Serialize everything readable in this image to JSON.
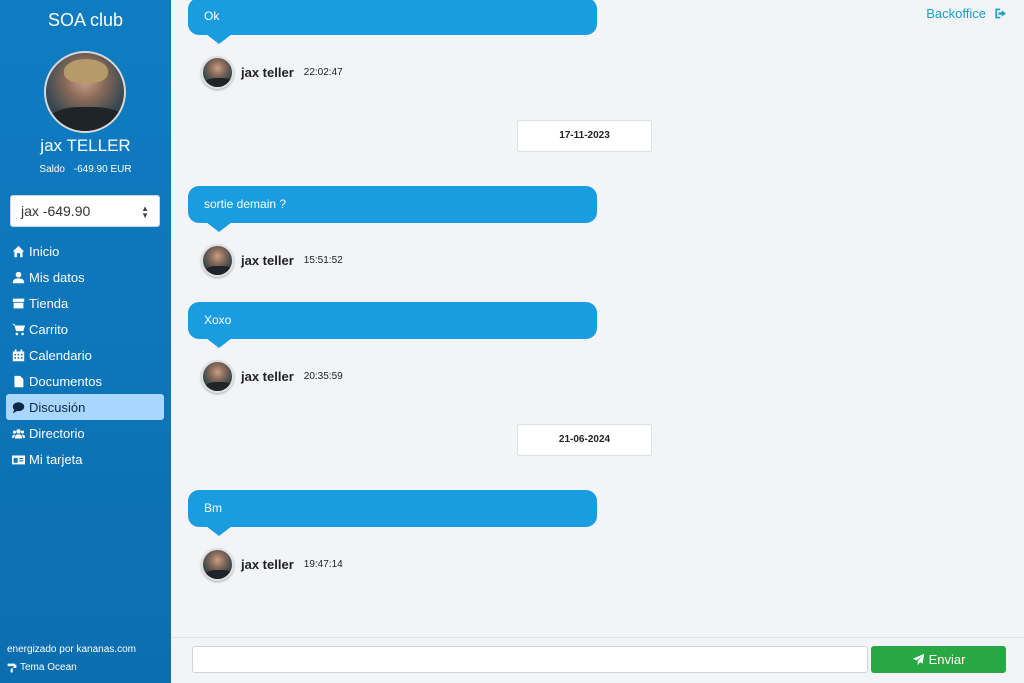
{
  "app": {
    "club_name": "SOA club"
  },
  "user": {
    "name": "jax TELLER",
    "saldo_label": "Saldo",
    "saldo_value": "-649.90 EUR"
  },
  "account_select": {
    "selected": "jax -649.90"
  },
  "sidebar": {
    "items": [
      {
        "label": "Inicio",
        "icon": "home-icon"
      },
      {
        "label": "Mis datos",
        "icon": "user-icon"
      },
      {
        "label": "Tienda",
        "icon": "store-icon"
      },
      {
        "label": "Carrito",
        "icon": "cart-icon"
      },
      {
        "label": "Calendario",
        "icon": "calendar-icon"
      },
      {
        "label": "Documentos",
        "icon": "document-icon"
      },
      {
        "label": "Discusión",
        "icon": "comment-icon",
        "active": true
      },
      {
        "label": "Directorio",
        "icon": "users-icon"
      },
      {
        "label": "Mi tarjeta",
        "icon": "id-card-icon"
      }
    ],
    "powered_by": "energizado por kananas.com",
    "theme": "Tema Ocean"
  },
  "header": {
    "backoffice_label": "Backoffice"
  },
  "messages": [
    {
      "text": "Ok",
      "author": "jax teller",
      "time": "22:02:47"
    },
    {
      "date_separator": "17-11-2023"
    },
    {
      "text": "sortie demain ?",
      "author": "jax teller",
      "time": "15:51:52"
    },
    {
      "text": "Xoxo",
      "author": "jax teller",
      "time": "20:35:59"
    },
    {
      "date_separator": "21-06-2024"
    },
    {
      "text": "Bm",
      "author": "jax teller",
      "time": "19:47:14"
    }
  ],
  "composer": {
    "value": "",
    "send_label": "Enviar"
  },
  "colors": {
    "sidebar": "#0f7cc2",
    "bubble": "#1a9de0",
    "send": "#28a745",
    "active_nav": "#a9d6ff",
    "link": "#1a9fc9"
  }
}
